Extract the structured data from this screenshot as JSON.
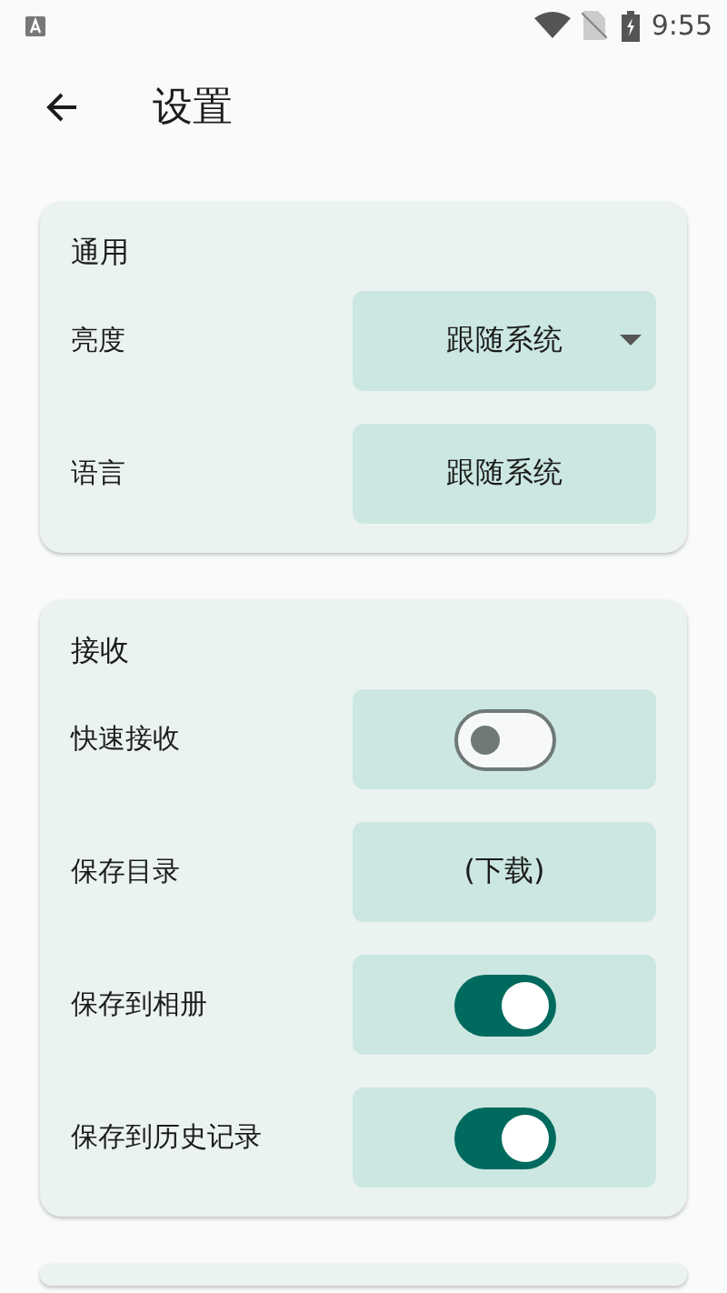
{
  "status_bar": {
    "time": "9:55"
  },
  "header": {
    "title": "设置"
  },
  "sections": [
    {
      "title": "通用",
      "rows": [
        {
          "kind": "dropdown",
          "label": "亮度",
          "value": "跟随系统"
        },
        {
          "kind": "button",
          "label": "语言",
          "value": "跟随系统"
        }
      ]
    },
    {
      "title": "接收",
      "rows": [
        {
          "kind": "switch",
          "label": "快速接收",
          "on": false
        },
        {
          "kind": "button",
          "label": "保存目录",
          "value": "(下载)"
        },
        {
          "kind": "switch",
          "label": "保存到相册",
          "on": true
        },
        {
          "kind": "switch",
          "label": "保存到历史记录",
          "on": true
        }
      ]
    }
  ]
}
